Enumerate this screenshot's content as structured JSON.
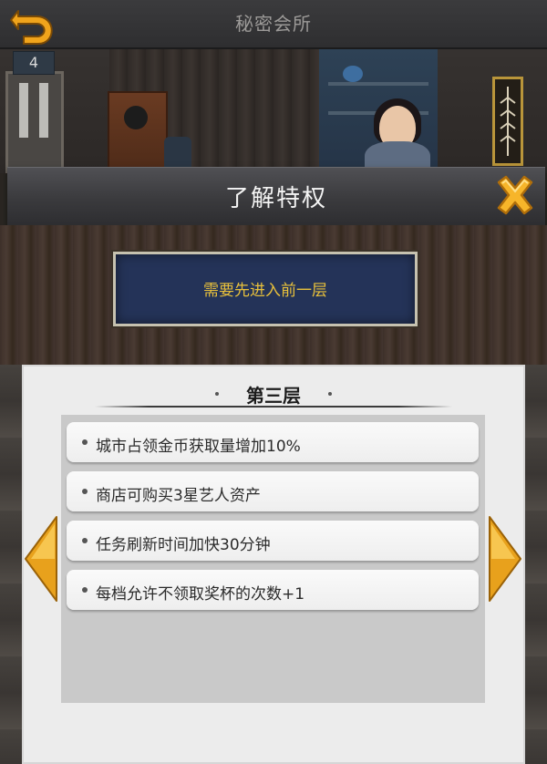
{
  "topbar": {
    "title": "秘密会所",
    "floor_number": "4"
  },
  "header": {
    "title": "了解特权"
  },
  "locked": {
    "message": "需要先进入前一层"
  },
  "panel": {
    "floor_title": "第三层",
    "perks": [
      "城市占领金币获取量增加10%",
      "商店可购买3星艺人资产",
      "任务刷新时间加快30分钟",
      "每档允许不领取奖杯的次数+1"
    ]
  },
  "colors": {
    "accent_gold": "#e9c13b",
    "banner_blue": "#243358",
    "icon_orange": "#f0a41c"
  },
  "icons": {
    "back": "back-arrow-icon",
    "close": "close-x-icon",
    "prev": "left-arrow-icon",
    "next": "right-arrow-icon"
  }
}
